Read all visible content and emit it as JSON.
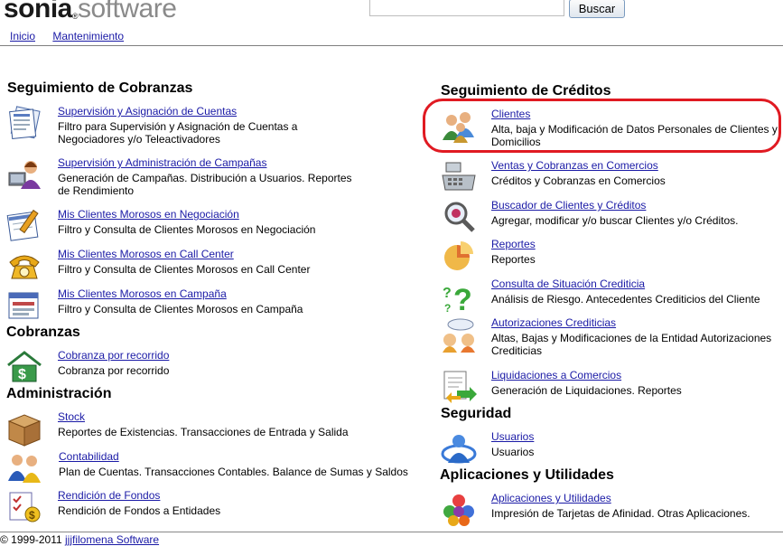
{
  "header": {
    "logo_bold": "sonia",
    "logo_mark": "®",
    "logo_rest": "software",
    "search_placeholder": "",
    "search_button": "Buscar"
  },
  "nav": {
    "items": [
      "Inicio",
      "Mantenimiento"
    ]
  },
  "left": {
    "cobranzas_title": "Seguimiento de Cobranzas",
    "cobranzas_items": [
      {
        "title": "Supervisión y Asignación de Cuentas",
        "desc": "Filtro para Supervisión y Asignación de Cuentas a Negociadores y/o Teleactivadores",
        "icon": "accounts-form-icon"
      },
      {
        "title": "Supervisión y Administración de Campañas",
        "desc": "Generación de Campañas. Distribución a Usuarios. Reportes de Rendimiento",
        "icon": "campaign-user-icon"
      },
      {
        "title": "Mis Clientes Morosos en Negociación",
        "desc": "Filtro y Consulta de Clientes Morosos en Negociación",
        "icon": "notepad-pencil-icon"
      },
      {
        "title": "Mis Clientes Morosos en Call Center",
        "desc": "Filtro y Consulta de Clientes Morosos en Call Center",
        "icon": "telephone-icon"
      },
      {
        "title": "Mis Clientes Morosos en Campaña",
        "desc": "Filtro y Consulta de Clientes Morosos en Campaña",
        "icon": "calendar-window-icon"
      }
    ],
    "cob_title": "Cobranzas",
    "cob_items": [
      {
        "title": "Cobranza por recorrido",
        "desc": "Cobranza por recorrido",
        "icon": "money-house-icon"
      }
    ],
    "admin_title": "Administración",
    "admin_items": [
      {
        "title": "Stock",
        "desc": "Reportes de Existencias. Transacciones de Entrada y Salida",
        "icon": "wooden-box-icon"
      },
      {
        "title": "Contabilidad",
        "desc": "Plan de Cuentas. Transacciones Contables. Balance de Sumas y Saldos",
        "icon": "people-accounting-icon"
      },
      {
        "title": "Rendición de Fondos",
        "desc": "Rendición de Fondos a Entidades",
        "icon": "checklist-money-icon"
      }
    ]
  },
  "right": {
    "creditos_title": "Seguimiento de Créditos",
    "creditos_items": [
      {
        "title": "Clientes",
        "desc": "Alta, baja y Modificación de Datos Personales de Clientes y Domicilios",
        "icon": "clients-group-icon"
      },
      {
        "title": "Ventas y Cobranzas en Comercios",
        "desc": "Créditos y Cobranzas en Comercios",
        "icon": "cash-register-icon"
      },
      {
        "title": "Buscador de Clientes y Créditos",
        "desc": "Agregar, modificar y/o buscar Clientes y/o Créditos.",
        "icon": "magnifier-icon"
      },
      {
        "title": "Reportes",
        "desc": "Reportes",
        "icon": "pie-chart-icon"
      },
      {
        "title": "Consulta de Situación Crediticia",
        "desc": "Análisis de Riesgo. Antecedentes Crediticios del Cliente",
        "icon": "question-mark-icon"
      },
      {
        "title": "Autorizaciones Crediticias",
        "desc": "Altas, Bajas y Modificaciones de la Entidad Autorizaciones Crediticias",
        "icon": "conversation-icon"
      },
      {
        "title": "Liquidaciones a Comercios",
        "desc": "Generación de Liquidaciones. Reportes",
        "icon": "document-arrows-icon"
      }
    ],
    "seg_title": "Seguridad",
    "seg_items": [
      {
        "title": "Usuarios",
        "desc": "Usuarios",
        "icon": "user-globe-icon"
      }
    ],
    "apps_title": "Aplicaciones y Utilidades",
    "apps_items": [
      {
        "title": "Aplicaciones y Utilidades",
        "desc": "Impresión de Tarjetas de Afinidad. Otras Aplicaciones.",
        "icon": "colored-balls-icon"
      }
    ]
  },
  "footer": {
    "copyright": "© 1999-2011",
    "link": "jjjfilomena Software"
  },
  "colors": {
    "link": "#1a1aa6",
    "highlight": "#e01a22",
    "rule": "#7f7f7f"
  }
}
